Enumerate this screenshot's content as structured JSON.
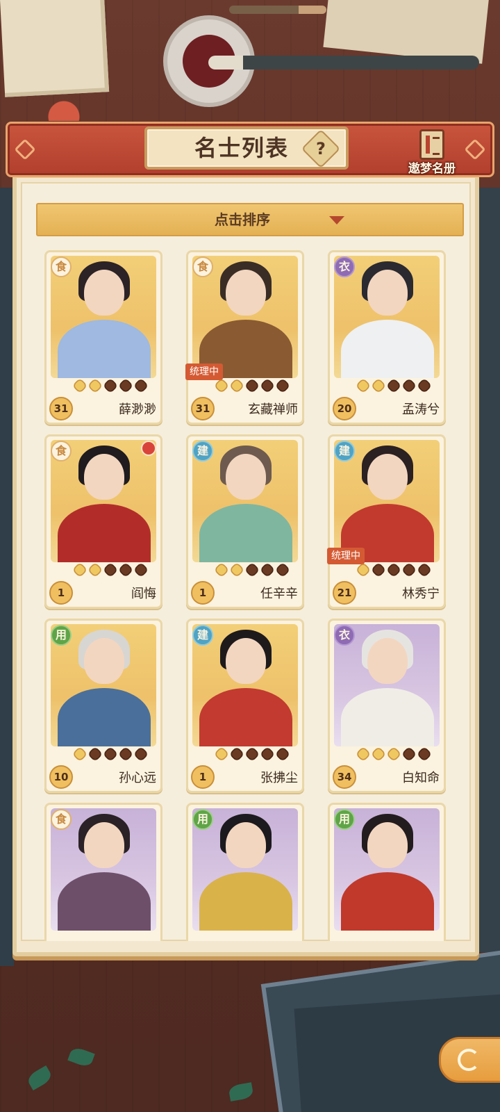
{
  "header": {
    "title": "名士列表",
    "help_glyph": "?",
    "album_label": "遨梦名册"
  },
  "sort": {
    "label": "点击排序"
  },
  "cards": [
    {
      "name": "薛渺渺",
      "level": "31",
      "type": "食",
      "stars_on": 2,
      "bg": "gold",
      "status": ""
    },
    {
      "name": "玄藏禅师",
      "level": "31",
      "type": "食",
      "stars_on": 2,
      "bg": "gold",
      "status": "统理中"
    },
    {
      "name": "孟涛兮",
      "level": "20",
      "type": "衣",
      "stars_on": 2,
      "bg": "gold",
      "status": ""
    },
    {
      "name": "阎悔",
      "level": "1",
      "type": "食",
      "stars_on": 2,
      "bg": "gold",
      "status": ""
    },
    {
      "name": "任辛辛",
      "level": "1",
      "type": "建",
      "stars_on": 2,
      "bg": "gold",
      "status": ""
    },
    {
      "name": "林秀宁",
      "level": "21",
      "type": "建",
      "stars_on": 1,
      "bg": "gold",
      "status": "统理中"
    },
    {
      "name": "孙心远",
      "level": "10",
      "type": "用",
      "stars_on": 1,
      "bg": "gold",
      "status": ""
    },
    {
      "name": "张拂尘",
      "level": "1",
      "type": "建",
      "stars_on": 1,
      "bg": "gold",
      "status": ""
    },
    {
      "name": "白知命",
      "level": "34",
      "type": "衣",
      "stars_on": 3,
      "bg": "purple",
      "status": ""
    },
    {
      "name": "",
      "level": "",
      "type": "食",
      "stars_on": 0,
      "bg": "purple",
      "status": ""
    },
    {
      "name": "",
      "level": "",
      "type": "用",
      "stars_on": 0,
      "bg": "purple",
      "status": ""
    },
    {
      "name": "",
      "level": "",
      "type": "用",
      "stars_on": 0,
      "bg": "purple",
      "status": ""
    }
  ],
  "colors": {
    "header_red": "#b13f2d",
    "sort_gold": "#e4b154",
    "card_gold": "#f2cf78",
    "card_purple": "#c8b2d8"
  },
  "icons": {
    "help": "help-icon",
    "album": "book-icon",
    "sort": "triangle-down-icon",
    "back": "back-arrow-icon"
  }
}
